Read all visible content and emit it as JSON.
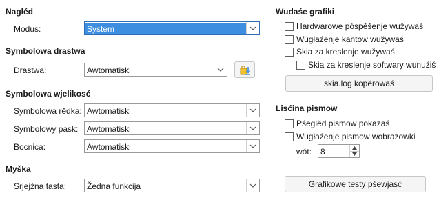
{
  "left": {
    "nagled": {
      "heading": "Nagléd",
      "modus_label": "Modus:",
      "modus_value": "System"
    },
    "symbolowa_drastwa": {
      "heading": "Symbolowa drastwa",
      "drastwa_label": "Drastwa:",
      "drastwa_value": "Awtomatiski"
    },
    "symbolowa_wjelikosc": {
      "heading": "Symbolowa wjelikosć",
      "redka_label": "Symbolowa rědka:",
      "redka_value": "Awtomatiski",
      "pask_label": "Symbolowy pask:",
      "pask_value": "Awtomatiski",
      "bocnica_label": "Bocnica:",
      "bocnica_value": "Awtomatiski"
    },
    "myska": {
      "heading": "Myška",
      "srjejzna_label": "Srjejźna tasta:",
      "srjejzna_value": "Žedna funkcija"
    }
  },
  "right": {
    "grafiki": {
      "heading": "Wudaśe grafiki",
      "cb_hardware": "Hardwarowe póspěšenje wužywaś",
      "cb_kanty": "Wugłaźenje kantow wužywaś",
      "cb_skia": "Skia za kreslenje wužywaś",
      "cb_skia_sw": "Skia za kreslenje softwary wunuźiś",
      "skia_log_button": "skia.log kopěrowaś"
    },
    "liscina": {
      "heading": "Lisćina pismow",
      "cb_pregled": "Pśeglěd pismow pokazaś",
      "cb_wuglazenje": "Wugłaźenje pismow wobrazowki",
      "wot_label": "wót:",
      "wot_value": "8",
      "testy_button": "Grafikowe testy pśewjasć"
    }
  },
  "colors": {
    "selection": "#3d8ee0",
    "border": "#9a9a9a"
  }
}
